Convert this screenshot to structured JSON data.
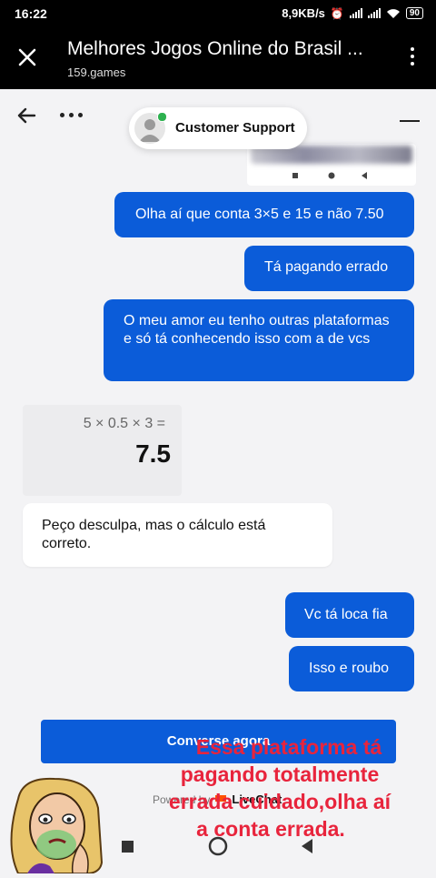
{
  "status_bar": {
    "time": "16:22",
    "net_speed": "8,9KB/s",
    "battery": "90"
  },
  "app_bar": {
    "title": "Melhores Jogos Online do Brasil ...",
    "url": "159.games"
  },
  "chat_header": {
    "agent_name": "Customer Support"
  },
  "messages_out": [
    "Olha aí que conta 3×5 e 15 e não 7.50",
    "Tá pagando errado",
    "O meu amor eu tenho outras plataformas e só tá conhecendo isso com a de vcs",
    "Vc tá loca fia",
    "Isso e roubo"
  ],
  "calc_image": {
    "expression": "5 × 0.5 × 3 =",
    "result": "7.5"
  },
  "messages_in": [
    "Peço desculpa, mas o cálculo está correto."
  ],
  "cta_label": "Converse agora",
  "powered": {
    "prefix": "Powered by",
    "brand": "LiveChat"
  },
  "overlay_text": [
    "Essa plataforma tá",
    "pagando totalmente",
    "errada cuidado,olha aí",
    "a conta errada."
  ],
  "colors": {
    "accent": "#0b5cd9",
    "overlay_text": "#e8243c"
  }
}
